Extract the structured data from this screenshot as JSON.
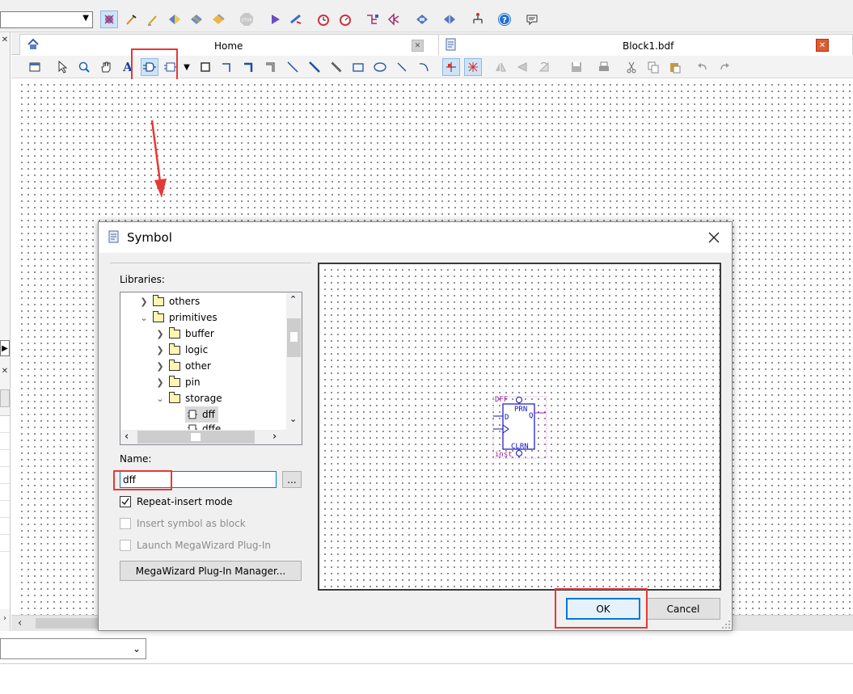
{
  "colors": {
    "highlight_red": "#e53935",
    "accent_blue": "#0078d7",
    "symbol_purple": "#a020a0",
    "symbol_blue": "#1010c0"
  },
  "tabs": [
    {
      "label": "Home",
      "icon": "home-icon"
    },
    {
      "label": "Block1.bdf",
      "icon": "block-diagram-icon"
    }
  ],
  "dialog": {
    "title": "Symbol",
    "libraries_label": "Libraries:",
    "tree": [
      {
        "label": "others",
        "level": 1,
        "expanded": false
      },
      {
        "label": "primitives",
        "level": 1,
        "expanded": true
      },
      {
        "label": "buffer",
        "level": 2,
        "expanded": false
      },
      {
        "label": "logic",
        "level": 2,
        "expanded": false
      },
      {
        "label": "other",
        "level": 2,
        "expanded": false
      },
      {
        "label": "pin",
        "level": 2,
        "expanded": false
      },
      {
        "label": "storage",
        "level": 2,
        "expanded": true
      },
      {
        "label": "dff",
        "level": 3,
        "selected": true
      },
      {
        "label": "dffe",
        "level": 3
      }
    ],
    "name_label": "Name:",
    "name_value": "dff",
    "browse_label": "...",
    "repeat_insert": {
      "label": "Repeat-insert mode",
      "checked": true,
      "enabled": true
    },
    "insert_as_block": {
      "label": "Insert symbol as block",
      "checked": false,
      "enabled": false
    },
    "launch_megawizard": {
      "label": "Launch MegaWizard Plug-In",
      "checked": false,
      "enabled": false
    },
    "megawizard_button": "MegaWizard Plug-In Manager...",
    "ok": "OK",
    "cancel": "Cancel",
    "preview": {
      "top_label": "DFF",
      "pin_prn": "PRN",
      "pin_d": "D",
      "pin_q": "Q",
      "pin_clrn": "CLRN",
      "instance": "inst"
    }
  }
}
